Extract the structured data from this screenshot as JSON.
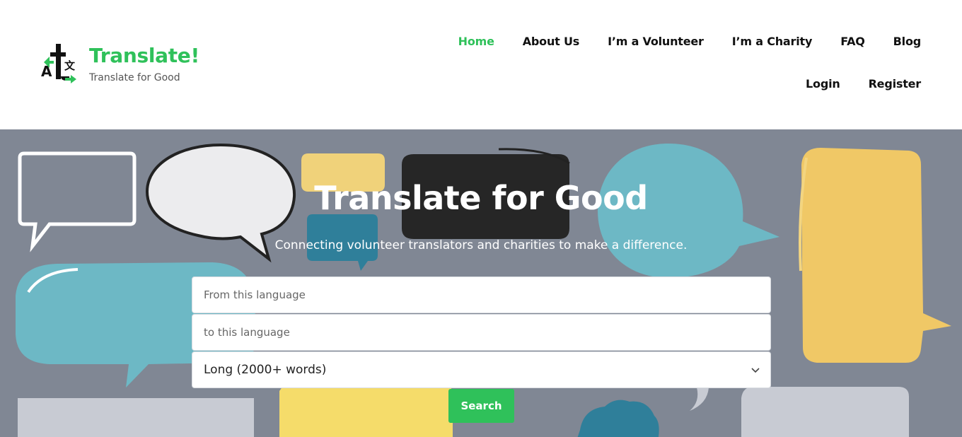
{
  "brand": {
    "title": "Translate!",
    "subtitle": "Translate for Good",
    "logo_icon": "translate-logo-icon"
  },
  "nav": {
    "items": [
      {
        "label": "Home",
        "active": true
      },
      {
        "label": "About Us",
        "active": false
      },
      {
        "label": "I’m a Volunteer",
        "active": false
      },
      {
        "label": "I’m a Charity",
        "active": false
      },
      {
        "label": "FAQ",
        "active": false
      },
      {
        "label": "Blog",
        "active": false
      },
      {
        "label": "Login",
        "active": false
      },
      {
        "label": "Register",
        "active": false
      }
    ]
  },
  "hero": {
    "title": "Translate for Good",
    "subtitle": "Connecting volunteer translators and charities to make a difference."
  },
  "search": {
    "from_placeholder": "From this language",
    "to_placeholder": "to this language",
    "length_selected": "Long (2000+ words)",
    "button_label": "Search",
    "dropdown_icon": "chevron-down-icon"
  },
  "colors": {
    "brand_green": "#2fc15a",
    "hero_bg": "#808794",
    "bubble_teal": "#6db8c5",
    "bubble_yellow": "#f0c866",
    "bubble_dark": "#262626",
    "bubble_blue": "#2f7f9a"
  }
}
